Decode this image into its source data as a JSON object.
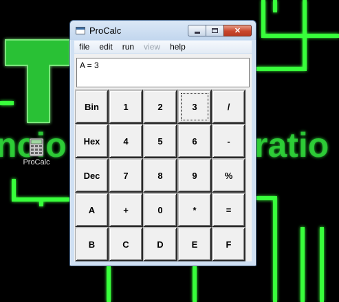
{
  "desktop": {
    "icon": {
      "label": "ProCalc",
      "icon_name": "calculator-icon"
    },
    "colors": {
      "neon_green": "#39ff3a",
      "background": "#000000"
    }
  },
  "window": {
    "title": "ProCalc",
    "controls": {
      "minimize_icon": "minimize-icon",
      "maximize_icon": "maximize-icon",
      "close_label": "✕"
    },
    "menu": [
      {
        "label": "file",
        "enabled": true
      },
      {
        "label": "edit",
        "enabled": true
      },
      {
        "label": "run",
        "enabled": true
      },
      {
        "label": "view",
        "enabled": false
      },
      {
        "label": "help",
        "enabled": true
      }
    ],
    "display_text": "A = 3",
    "keys": [
      [
        "Bin",
        "1",
        "2",
        "3",
        "/"
      ],
      [
        "Hex",
        "4",
        "5",
        "6",
        "-"
      ],
      [
        "Dec",
        "7",
        "8",
        "9",
        "%"
      ],
      [
        "A",
        "+",
        "0",
        "*",
        "="
      ],
      [
        "B",
        "C",
        "D",
        "E",
        "F"
      ]
    ],
    "focused_key": "3"
  }
}
